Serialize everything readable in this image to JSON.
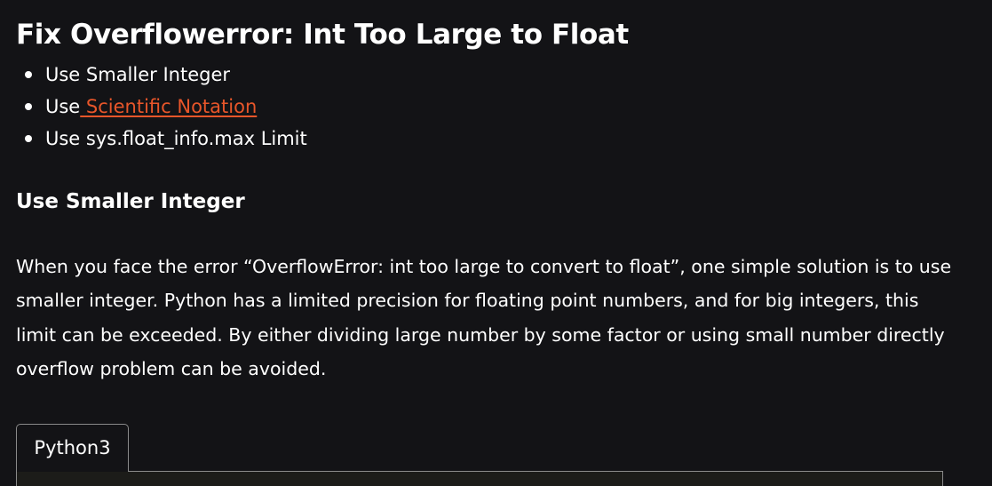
{
  "article": {
    "heading": "Fix Overflowerror: Int Too Large to Float",
    "toc": [
      {
        "prefix": "Use Smaller Integer",
        "link": ""
      },
      {
        "prefix": "Use",
        "link": " Scientific Notation"
      },
      {
        "prefix": "Use sys.float_info.max Limit",
        "link": ""
      }
    ],
    "section_heading": "Use Smaller Integer",
    "paragraph": "When you face the error “OverflowError: int too large to convert to float”, one simple solution is to use smaller integer. Python has a limited precision for floating point numbers, and for big integers, this limit can be exceeded. By either dividing large number by some factor or using small number directly overflow problem can be avoided.",
    "code_tab_label": "Python3"
  },
  "colors": {
    "background": "#131316",
    "text": "#ffffff",
    "link": "#e8562a",
    "code_border": "#8a8a8a"
  }
}
